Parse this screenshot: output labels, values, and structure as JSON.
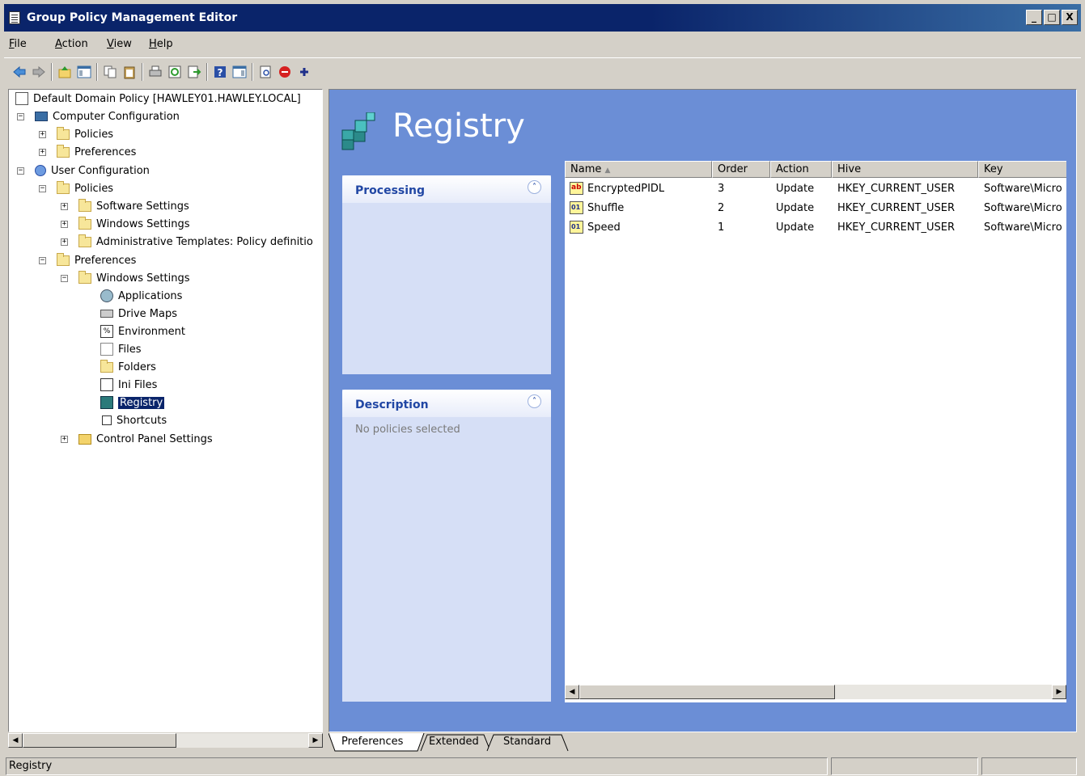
{
  "window": {
    "title": "Group Policy Management Editor"
  },
  "title_buttons": [
    "_",
    "□",
    "X"
  ],
  "menu": [
    "File",
    "Action",
    "View",
    "Help"
  ],
  "toolbar_icons": [
    "back-arrow-icon",
    "forward-arrow-icon",
    "up-folder-icon",
    "show-hide-tree-icon",
    "copy-icon",
    "paste-icon",
    "print-icon",
    "refresh-icon",
    "export-list-icon",
    "help-icon",
    "show-hide-action-pane-icon",
    "properties-icon",
    "stop-icon",
    "add-icon"
  ],
  "tree": {
    "root": "Default Domain Policy [HAWLEY01.HAWLEY.LOCAL]",
    "computer_configuration": "Computer Configuration",
    "cc_policies": "Policies",
    "cc_preferences": "Preferences",
    "user_configuration": "User Configuration",
    "uc_policies": "Policies",
    "software_settings": "Software Settings",
    "windows_settings": "Windows Settings",
    "admin_templates": "Administrative Templates: Policy definitio",
    "uc_preferences": "Preferences",
    "pref_windows_settings": "Windows Settings",
    "applications": "Applications",
    "drive_maps": "Drive Maps",
    "environment": "Environment",
    "files": "Files",
    "folders": "Folders",
    "ini_files": "Ini Files",
    "registry": "Registry",
    "shortcuts": "Shortcuts",
    "control_panel_settings": "Control Panel Settings"
  },
  "detail": {
    "heading": "Registry",
    "processing_title": "Processing",
    "description_title": "Description",
    "description_text": "No policies selected"
  },
  "list": {
    "columns": [
      "Name",
      "Order",
      "Action",
      "Hive",
      "Key"
    ],
    "sorted_column": "Name",
    "rows": [
      {
        "name": "EncryptedPIDL",
        "order": "3",
        "action": "Update",
        "hive": "HKEY_CURRENT_USER",
        "key": "Software\\Micro",
        "icon": "registry-string-icon"
      },
      {
        "name": "Shuffle",
        "order": "2",
        "action": "Update",
        "hive": "HKEY_CURRENT_USER",
        "key": "Software\\Micro",
        "icon": "registry-binary-icon"
      },
      {
        "name": "Speed",
        "order": "1",
        "action": "Update",
        "hive": "HKEY_CURRENT_USER",
        "key": "Software\\Micro",
        "icon": "registry-binary-icon"
      }
    ]
  },
  "tabs": [
    "Preferences",
    "Extended",
    "Standard"
  ],
  "active_tab": "Preferences",
  "status": {
    "text": "Registry"
  },
  "colors": {
    "titlebar": "#0a246a",
    "detail_background": "#6b8ed6",
    "panel_title": "#2147a4",
    "selection": "#0a246a"
  }
}
